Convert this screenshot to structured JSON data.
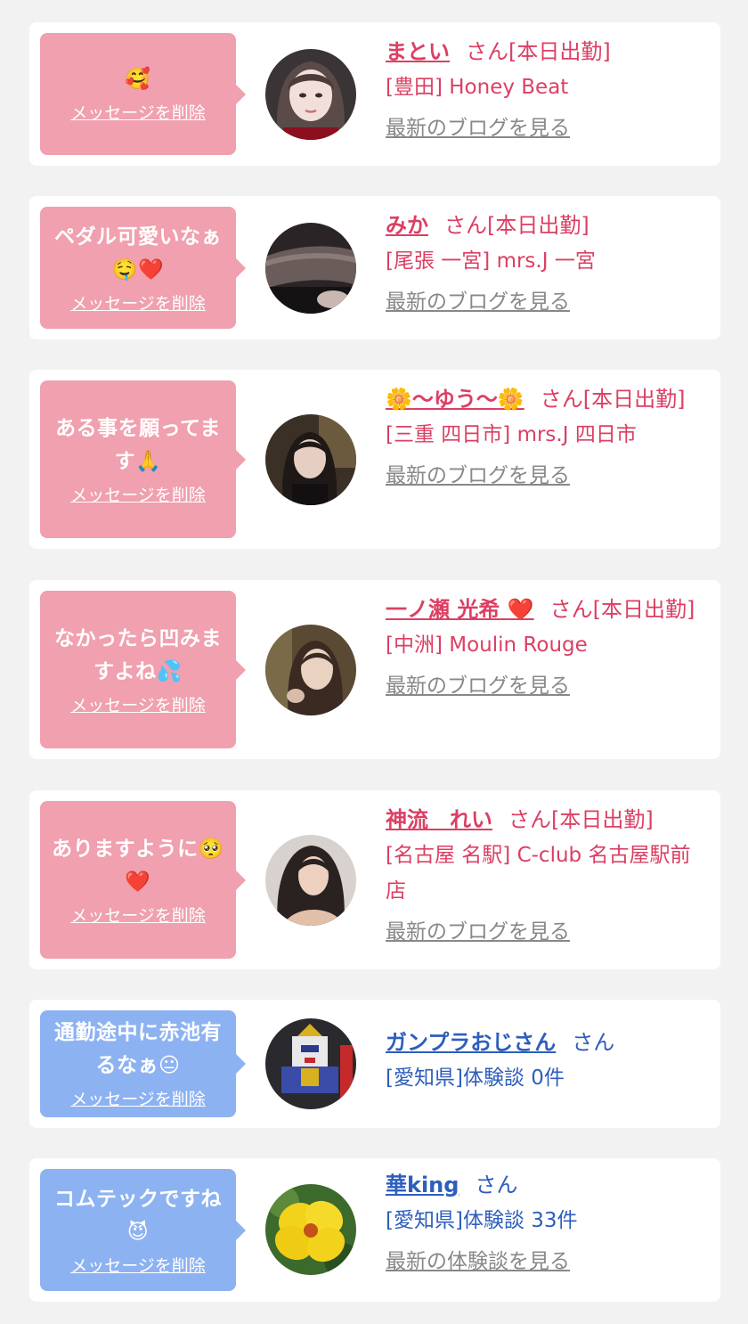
{
  "delete_label": "メッセージを削除",
  "colors": {
    "pink_bubble": "#f0a0ae",
    "blue_bubble": "#8db2f2",
    "pink_text": "#dc3f63",
    "blue_text": "#2e5ebd",
    "link_gray": "#888888",
    "background": "#f2f2f2"
  },
  "items": [
    {
      "message_text": "",
      "message_emoji": "🥰",
      "name": "まとい",
      "suffix": "さん[本日出勤]",
      "shop": "[豊田] Honey Beat",
      "link": "最新のブログを見る",
      "avatar_icon": "woman-portrait-photo"
    },
    {
      "message_text": "ペダル可愛いなぁ",
      "message_emoji": "🤤❤️",
      "name": "みか",
      "suffix": "さん[本日出勤]",
      "shop": "[尾張 一宮] mrs.J 一宮",
      "link": "最新のブログを見る",
      "avatar_icon": "legs-in-tights-photo"
    },
    {
      "message_text": "ある事を願ってます",
      "message_emoji": "🙏",
      "name_prefix": "🌼",
      "name": "〜ゆう〜",
      "name_suffix_emoji": "🌼",
      "suffix": "さん[本日出勤]",
      "shop": "[三重 四日市] mrs.J 四日市",
      "link": "最新のブログを見る",
      "avatar_icon": "woman-portrait-photo"
    },
    {
      "message_text": "なかったら凹みますよね",
      "message_emoji": "💦",
      "name": "一ノ瀬 光希",
      "name_suffix_emoji": "❤️",
      "suffix": "さん[本日出勤]",
      "shop": "[中洲] Moulin Rouge",
      "link": "最新のブログを見る",
      "avatar_icon": "woman-portrait-photo"
    },
    {
      "message_text": "ありますように",
      "message_emoji": "🥺❤️",
      "name": "神流　れい",
      "suffix": "さん[本日出勤]",
      "shop": "[名古屋 名駅] C-club 名古屋駅前店",
      "link": "最新のブログを見る",
      "avatar_icon": "woman-portrait-photo"
    },
    {
      "message_text": "通勤途中に赤池有るなぁ",
      "message_emoji": "😐",
      "name": "ガンプラおじさん",
      "suffix": "さん",
      "shop": "[愛知県]体験談 0件",
      "link": "",
      "avatar_icon": "gundam-model-photo"
    },
    {
      "message_text": "コムテックですね",
      "message_emoji": "😈",
      "name": "華king",
      "suffix": "さん",
      "shop": "[愛知県]体験談 33件",
      "link": "最新の体験談を見る",
      "avatar_icon": "yellow-hibiscus-photo"
    }
  ]
}
